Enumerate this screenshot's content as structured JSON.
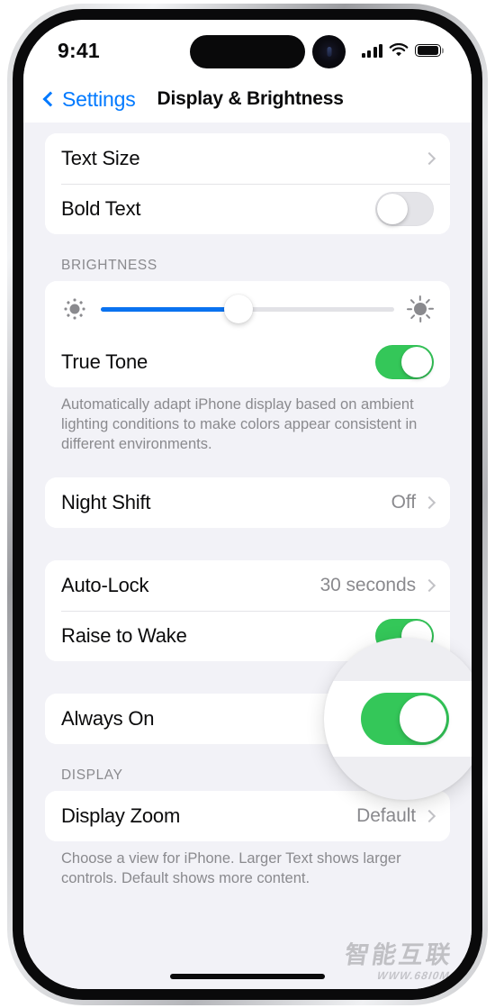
{
  "status_bar": {
    "time": "9:41",
    "cellular_icon": "cellular-bars-icon",
    "wifi_icon": "wifi-icon",
    "battery_icon": "battery-full-icon"
  },
  "nav": {
    "back_icon": "chevron-left-icon",
    "back_label": "Settings",
    "title": "Display & Brightness"
  },
  "sections": {
    "text": {
      "rows": [
        {
          "label": "Text Size",
          "accessory": "chevron-right-icon"
        },
        {
          "label": "Bold Text",
          "accessory": "toggle",
          "toggle_state": "off"
        }
      ]
    },
    "brightness": {
      "header": "BRIGHTNESS",
      "slider": {
        "name": "brightness-slider",
        "value_percent": 47,
        "min_icon": "sun-small-icon",
        "max_icon": "sun-large-icon",
        "fill_color": "#0a72f0",
        "track_color": "#e2e2e6"
      },
      "rows": [
        {
          "label": "True Tone",
          "accessory": "toggle",
          "toggle_state": "on"
        }
      ],
      "footer": "Automatically adapt iPhone display based on ambient lighting conditions to make colors appear consistent in different environments."
    },
    "night_shift": {
      "rows": [
        {
          "label": "Night Shift",
          "value": "Off",
          "accessory": "chevron-right-icon"
        }
      ]
    },
    "lock": {
      "rows": [
        {
          "label": "Auto-Lock",
          "value": "30 seconds",
          "accessory": "chevron-right-icon"
        },
        {
          "label": "Raise to Wake",
          "accessory": "toggle",
          "toggle_state": "on"
        }
      ]
    },
    "always_on": {
      "rows": [
        {
          "label": "Always On",
          "accessory": "toggle",
          "toggle_state": "on"
        }
      ]
    },
    "display": {
      "header": "DISPLAY",
      "rows": [
        {
          "label": "Display Zoom",
          "value": "Default",
          "accessory": "chevron-right-icon"
        }
      ],
      "footer": "Choose a view for iPhone. Larger Text shows larger controls. Default shows more content."
    }
  },
  "magnifier": {
    "name": "magnifier-lens",
    "target": "always-on-toggle",
    "toggle_state": "on"
  },
  "watermark": {
    "text_cn": "智能互联",
    "url": "WWW.68I0M"
  },
  "colors": {
    "accent_blue": "#037aff",
    "toggle_green": "#34c759",
    "slider_blue": "#0a72f0",
    "secondary_text": "#8a8a8e",
    "group_background": "#f2f2f7"
  }
}
